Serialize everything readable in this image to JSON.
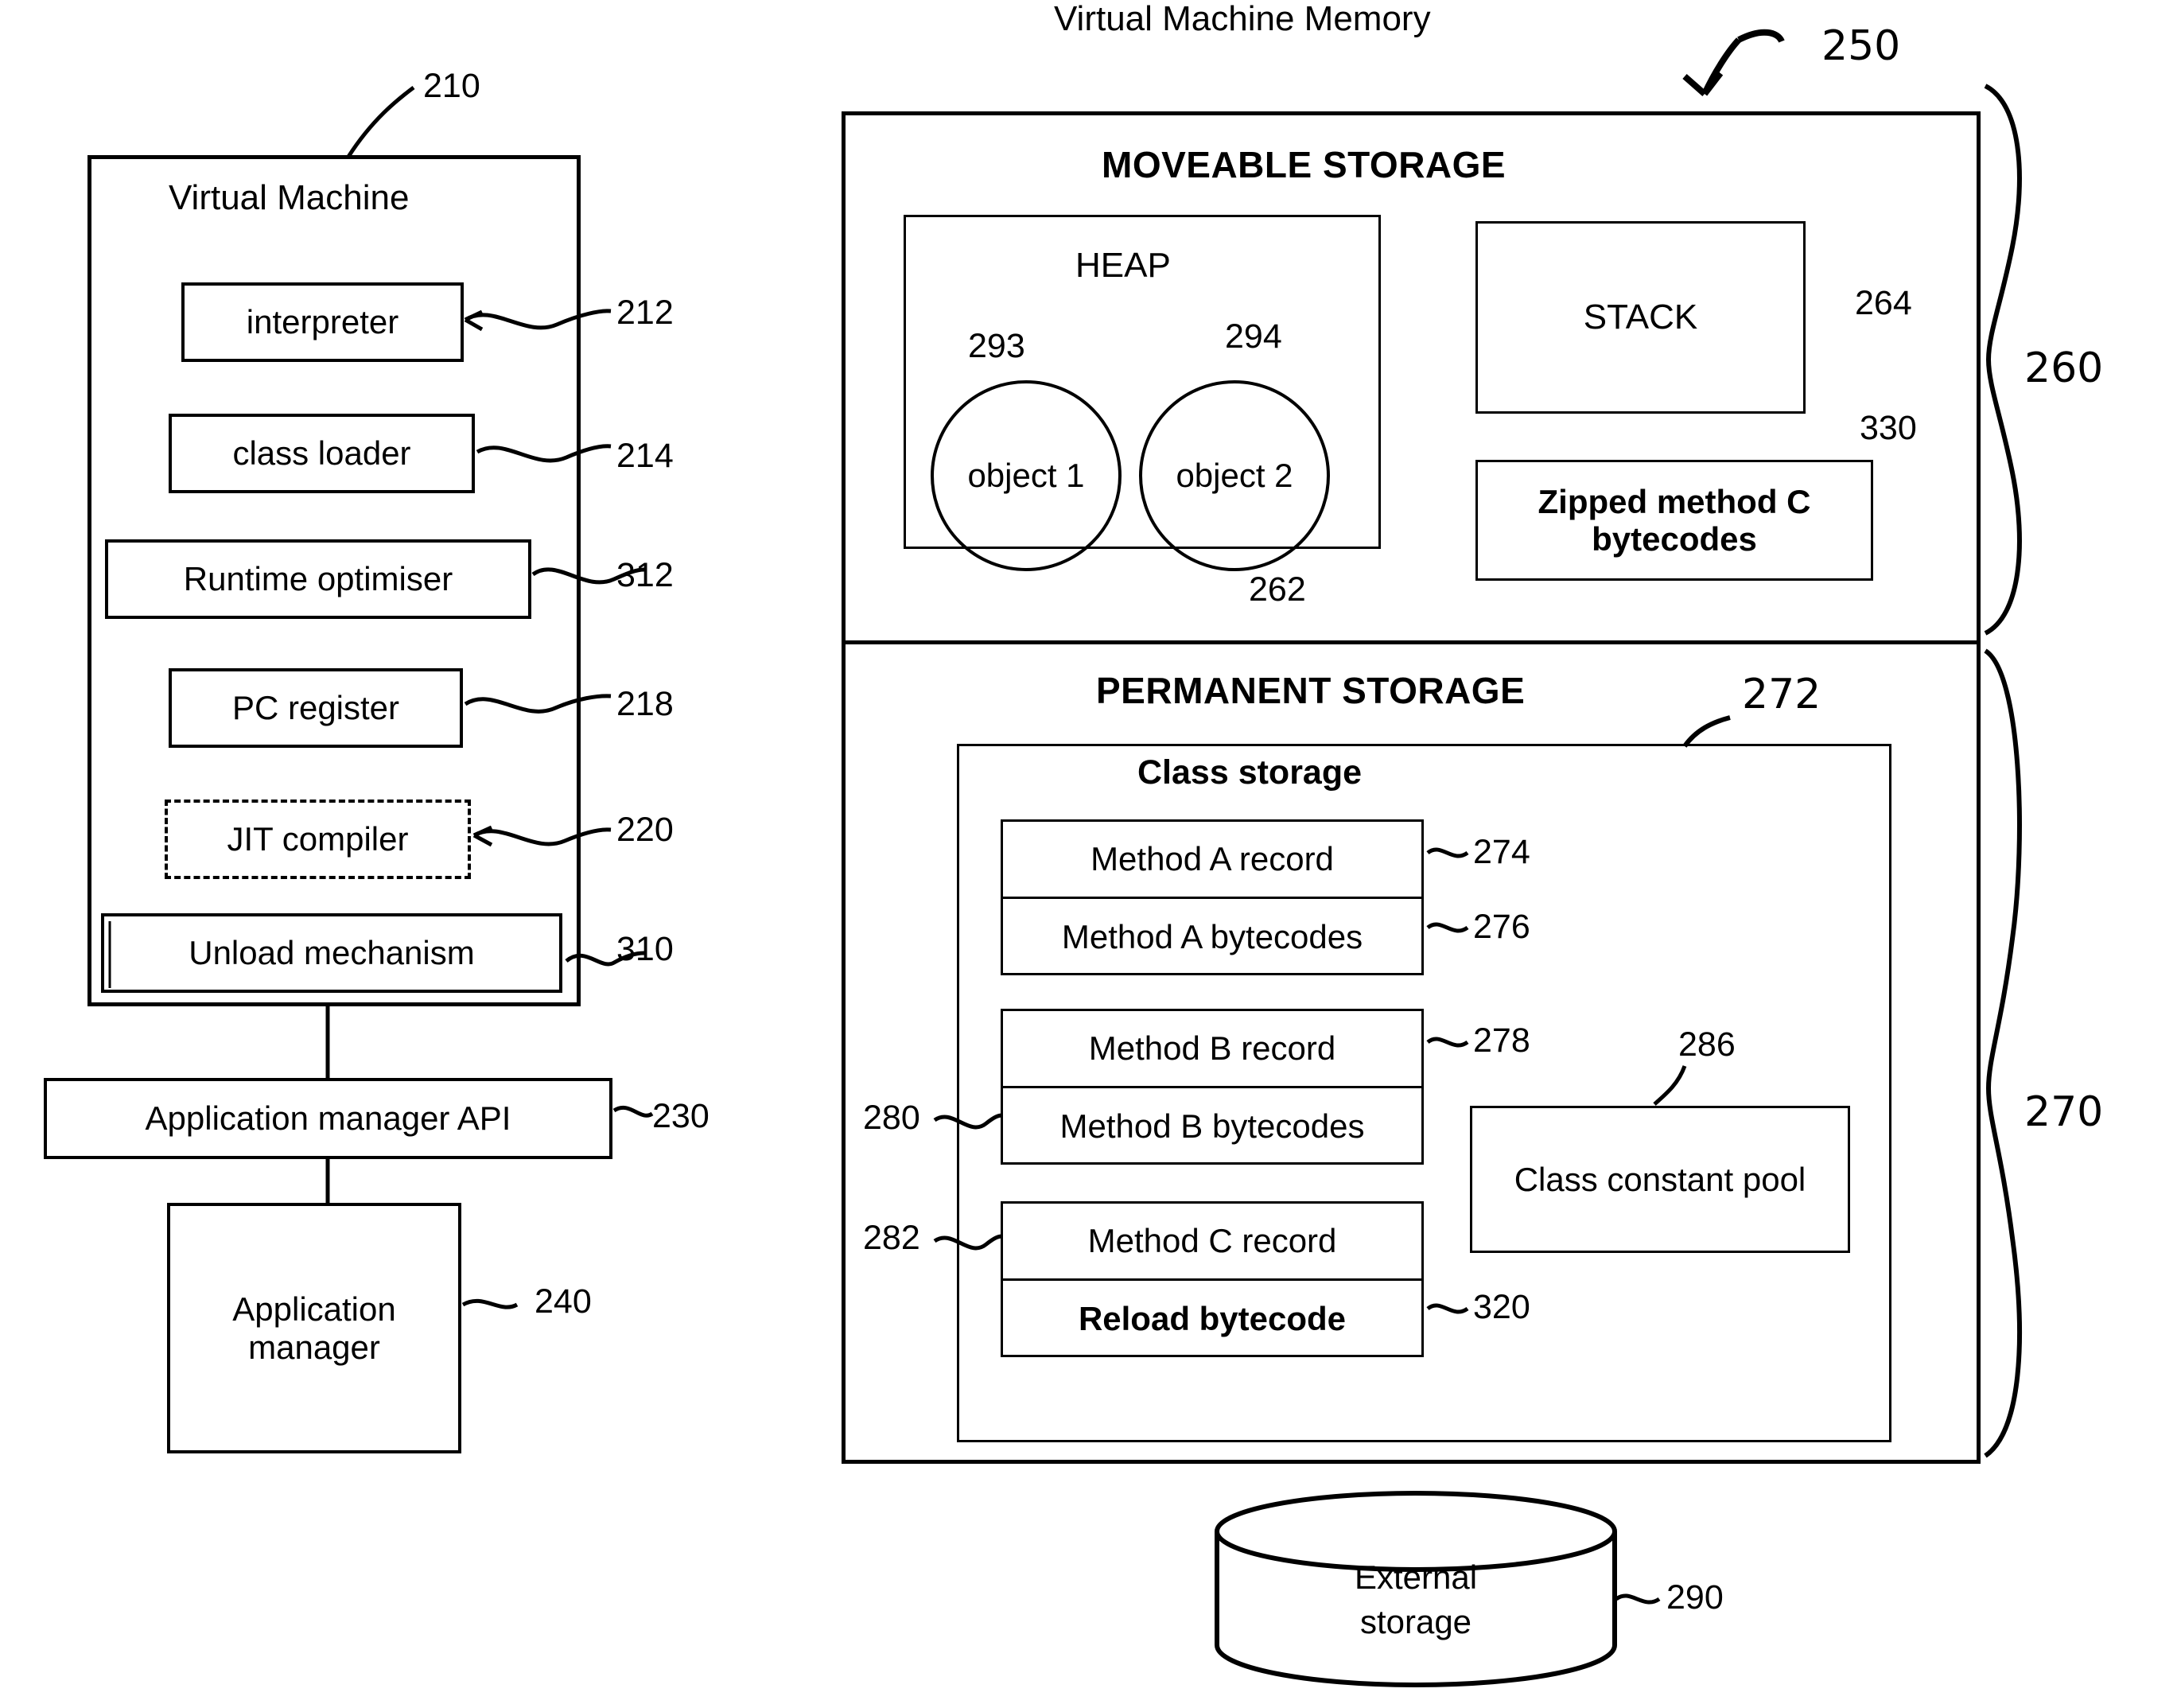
{
  "figure": {
    "title": "Virtual Machine Memory"
  },
  "vm": {
    "title": "Virtual Machine",
    "ref": "210",
    "components": [
      {
        "label": "interpreter",
        "ref": "212"
      },
      {
        "label": "class loader",
        "ref": "214"
      },
      {
        "label": "Runtime optimiser",
        "ref": "312"
      },
      {
        "label": "PC register",
        "ref": "218"
      },
      {
        "label": "JIT compiler",
        "ref": "220"
      },
      {
        "label": "Unload mechanism",
        "ref": "310"
      }
    ],
    "api": {
      "label": "Application manager API",
      "ref": "230"
    },
    "manager": {
      "label": "Application manager",
      "ref": "240"
    }
  },
  "memory": {
    "ref": "250",
    "moveable": {
      "heading": "MOVEABLE STORAGE",
      "ref": "260",
      "heap": {
        "label": "HEAP",
        "ref": "262",
        "objects": [
          {
            "label": "object 1",
            "ref": "293"
          },
          {
            "label": "object 2",
            "ref": "294"
          }
        ]
      },
      "stack": {
        "label": "STACK",
        "ref": "264"
      },
      "zipped": {
        "label": "Zipped method C bytecodes",
        "ref": "330"
      }
    },
    "permanent": {
      "heading": "PERMANENT STORAGE",
      "ref": "270",
      "class_storage": {
        "label": "Class storage",
        "ref": "272",
        "methods": [
          {
            "record": "Method A record",
            "record_ref": "274",
            "bytecodes": "Method A bytecodes",
            "bytecodes_ref": "276",
            "bytecodes_bold": false
          },
          {
            "record": "Method B record",
            "record_ref": "278",
            "bytecodes": "Method B bytecodes",
            "bytecodes_ref": "280",
            "bytecodes_bold": false
          },
          {
            "record": "Method C record",
            "record_ref": "282",
            "bytecodes": "Reload bytecode",
            "bytecodes_ref": "320",
            "bytecodes_bold": true
          }
        ],
        "constant_pool": {
          "label": "Class constant pool",
          "ref": "286"
        }
      }
    }
  },
  "external": {
    "label_line1": "External",
    "label_line2": "storage",
    "ref": "290"
  }
}
